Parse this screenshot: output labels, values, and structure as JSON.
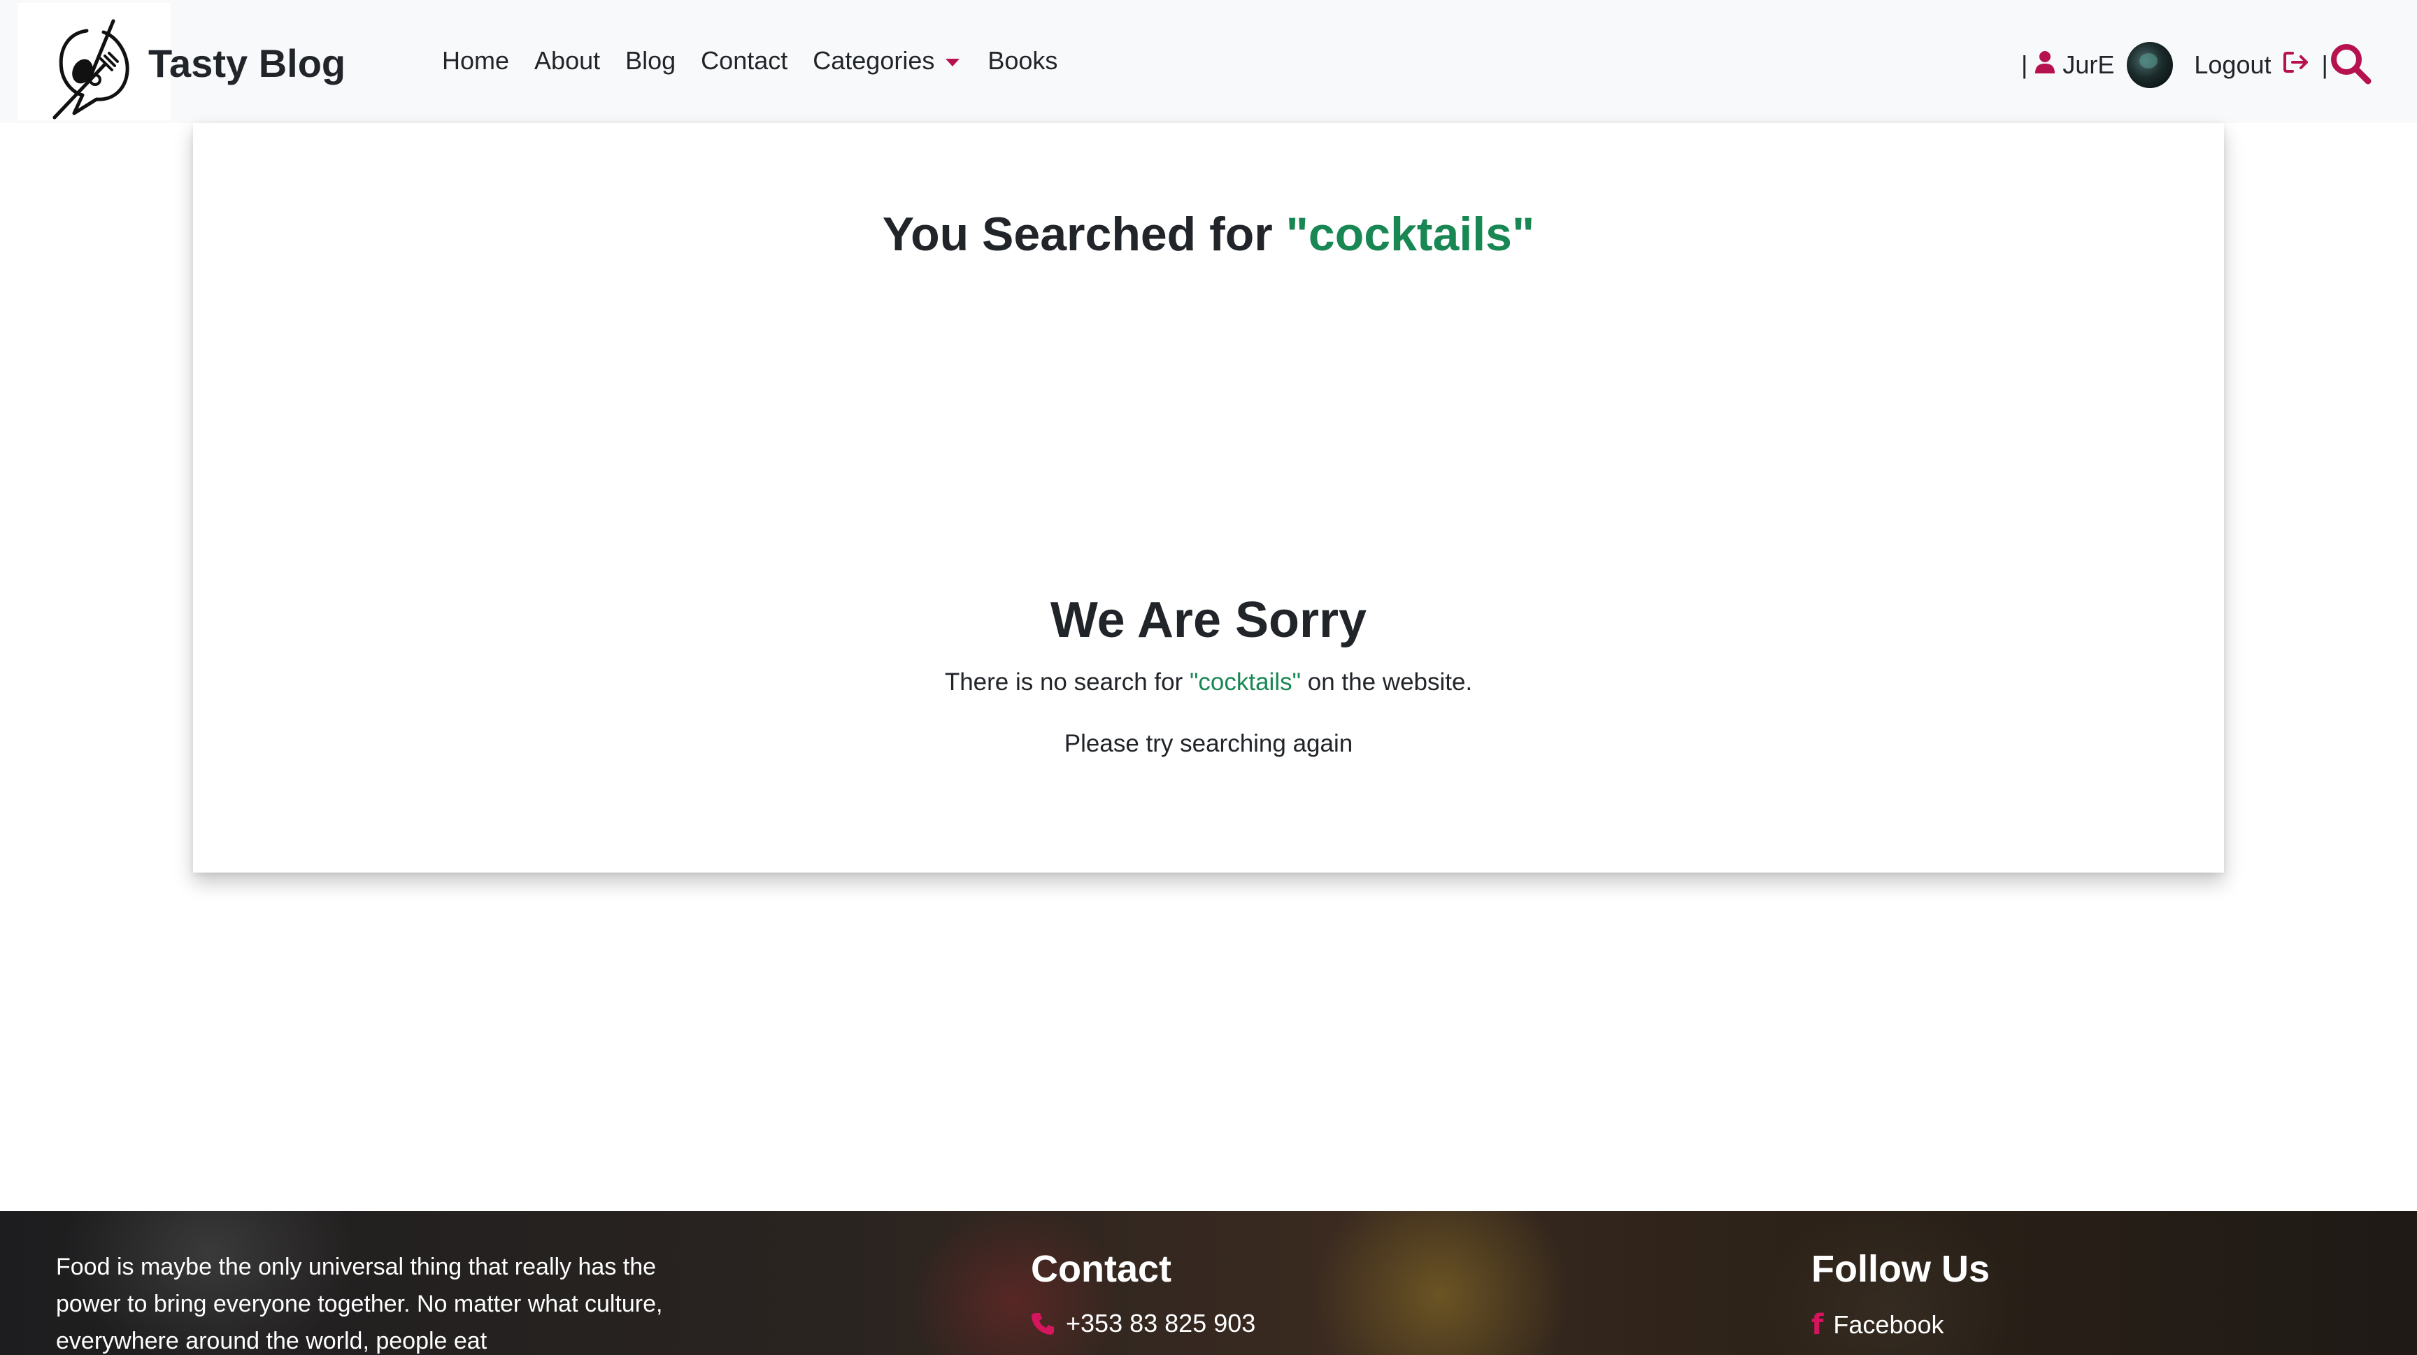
{
  "brand": {
    "name": "Tasty Blog",
    "logo_icon": "spoon-fork-chat-icon"
  },
  "nav": {
    "home": "Home",
    "about": "About",
    "blog": "Blog",
    "contact": "Contact",
    "categories": "Categories",
    "books": "Books"
  },
  "user": {
    "separator": "|",
    "username": "JurE",
    "logout": "Logout"
  },
  "search_results": {
    "title_prefix": "You Searched for ",
    "query_display": "\"cocktails\"",
    "sorry_title": "We Are Sorry",
    "sorry_prefix": "There is no search for ",
    "sorry_suffix": " on the website.",
    "retry_text": "Please try searching again"
  },
  "footer": {
    "about_text": "Food is maybe the only universal thing that really has the power to bring everyone together. No matter what culture, everywhere around the world, people eat",
    "contact_title": "Contact",
    "phone": "+353 83 825 903",
    "follow_title": "Follow Us",
    "facebook": "Facebook"
  },
  "colors": {
    "accent": "#b5124f",
    "highlight_green": "#198754",
    "navbar_bg": "#f8f9fa"
  }
}
